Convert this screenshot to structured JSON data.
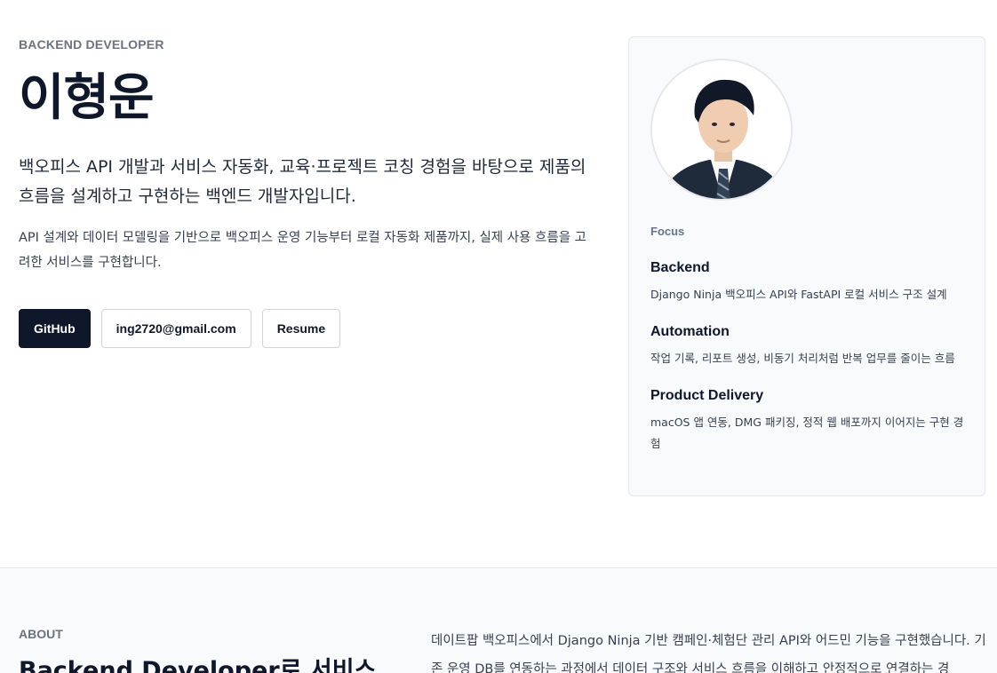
{
  "hero": {
    "eyebrow": "BACKEND DEVELOPER",
    "name": "이형운",
    "lead": "백오피스 API 개발과 서비스 자동화, 교육·프로젝트 코칭 경험을 바탕으로 제품의 흐름을 설계하고 구현하는 백엔드 개발자입니다.",
    "sub": "API 설계와 데이터 모델링을 기반으로 백오피스 운영 기능부터 로컬 자동화 제품까지, 실제 사용 흐름을 고려한 서비스를 구현합니다.",
    "buttons": {
      "github": "GitHub",
      "email": "ing2720@gmail.com",
      "resume": "Resume"
    }
  },
  "card": {
    "label": "Focus",
    "items": [
      {
        "title": "Backend",
        "desc": "Django Ninja 백오피스 API와 FastAPI 로컬 서비스 구조 설계"
      },
      {
        "title": "Automation",
        "desc": "작업 기록, 리포트 생성, 비동기 처리처럼 반복 업무를 줄이는 흐름"
      },
      {
        "title": "Product Delivery",
        "desc": "macOS 앱 연동, DMG 패키징, 정적 웹 배포까지 이어지는 구현 경험"
      }
    ]
  },
  "about": {
    "eyebrow": "ABOUT",
    "heading": "Backend Developer로 서비스",
    "text": "데이트팝 백오피스에서 Django Ninja 기반 캠페인·체험단 관리 API와 어드민 기능을 구현했습니다. 기존 운영 DB를 연동하는 과정에서 데이터 구조와 서비스 흐름을 이해하고 안정적으로 연결하는 경"
  }
}
